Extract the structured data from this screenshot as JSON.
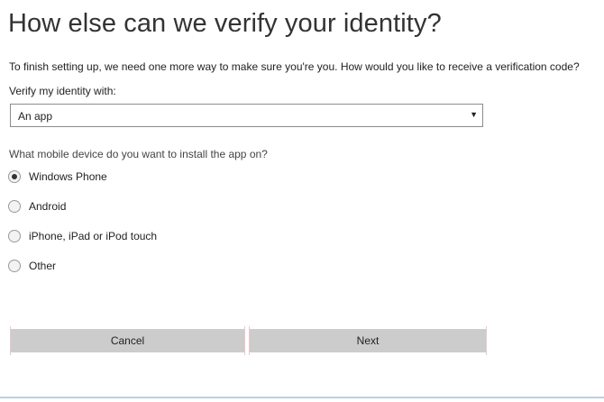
{
  "page": {
    "title": "How else can we verify your identity?",
    "intro": "To finish setting up, we need one more way to make sure you're you. How would you like to receive a verification code?"
  },
  "verify": {
    "label": "Verify my identity with:",
    "selected": "An app",
    "arrow_icon": "caret-down-icon"
  },
  "device": {
    "question": "What mobile device do you want to install the app on?",
    "options": [
      {
        "label": "Windows Phone",
        "checked": true
      },
      {
        "label": "Android",
        "checked": false
      },
      {
        "label": "iPhone, iPad or iPod touch",
        "checked": false
      },
      {
        "label": "Other",
        "checked": false
      }
    ]
  },
  "buttons": {
    "cancel": "Cancel",
    "next": "Next"
  }
}
